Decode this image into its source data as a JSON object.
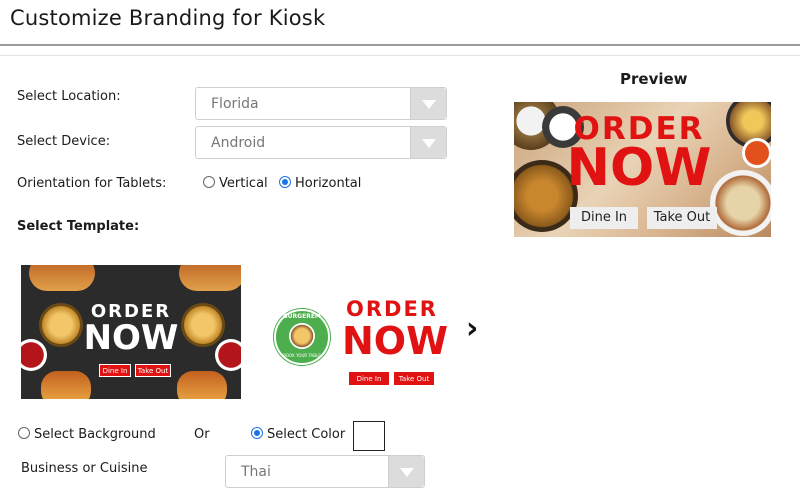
{
  "header": {
    "title": "Customize Branding for Kiosk"
  },
  "form": {
    "location_label": "Select Location:",
    "location_value": "Florida",
    "device_label": "Select Device:",
    "device_value": "Android",
    "orientation_label": "Orientation for Tablets:",
    "orientation_options": [
      {
        "label": "Vertical",
        "checked": false
      },
      {
        "label": "Horizontal",
        "checked": true
      }
    ],
    "template_label": "Select Template:",
    "background_option": "Select Background",
    "or_text": "Or",
    "color_option": "Select Color",
    "cuisine_label": "Business or Cuisine",
    "cuisine_value": "Thai"
  },
  "preview": {
    "title": "Preview",
    "order": "ORDER",
    "now": "NOW",
    "dine_in": "Dine In",
    "take_out": "Take Out"
  },
  "templates": [
    {
      "order": "ORDER",
      "now": "NOW",
      "dine_in": "Dine In",
      "take_out": "Take Out"
    },
    {
      "logo_top": "BURGEREM",
      "logo_bottom": "BOOK YOUR TABLE",
      "order": "ORDER",
      "now": "NOW",
      "dine_in": "Dine In",
      "take_out": "Take Out"
    }
  ],
  "icons": {
    "next": "chevron-right-icon",
    "dropdown": "chevron-down-icon"
  },
  "colors": {
    "accent_red": "#e11212",
    "radio_blue": "#1a73e8",
    "logo_green": "#4cae4c"
  }
}
